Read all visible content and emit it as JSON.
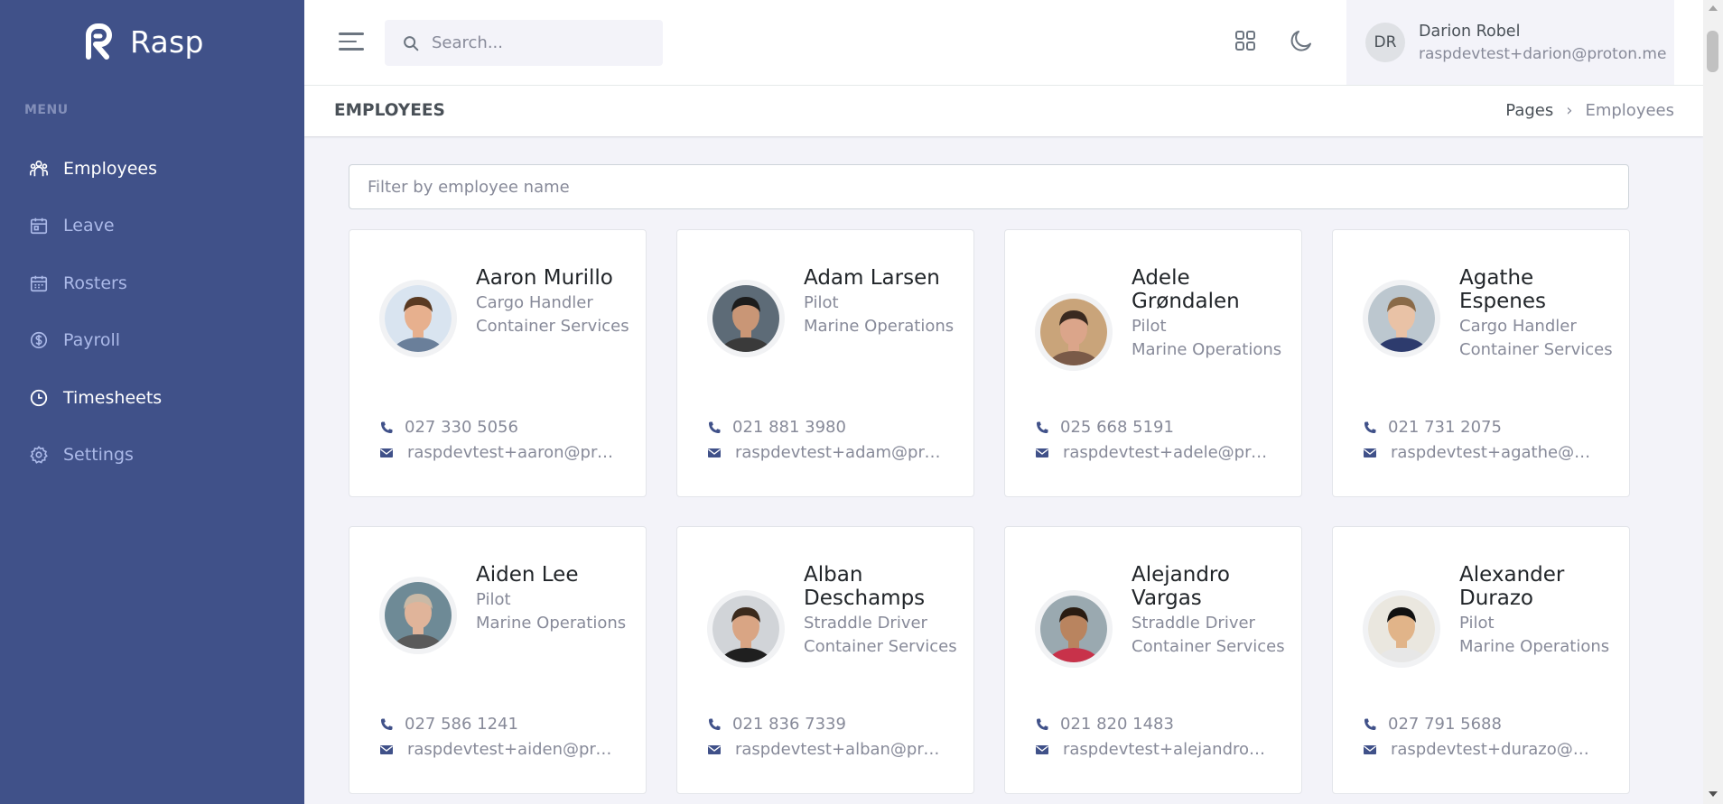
{
  "app": {
    "name": "Rasp"
  },
  "sidebar": {
    "menu_title": "MENU",
    "items": [
      {
        "label": "Employees",
        "icon": "users-icon"
      },
      {
        "label": "Leave",
        "icon": "calendar-icon"
      },
      {
        "label": "Rosters",
        "icon": "calendar-grid-icon"
      },
      {
        "label": "Payroll",
        "icon": "dollar-circle-icon"
      },
      {
        "label": "Timesheets",
        "icon": "clock-icon"
      },
      {
        "label": "Settings",
        "icon": "gear-icon"
      }
    ]
  },
  "topbar": {
    "search_placeholder": "Search...",
    "user": {
      "initials": "DR",
      "name": "Darion Robel",
      "email": "raspdevtest+darion@proton.me"
    }
  },
  "page": {
    "title": "EMPLOYEES",
    "breadcrumb": {
      "parent": "Pages",
      "separator": "›",
      "current": "Employees"
    },
    "filter_placeholder": "Filter by employee name"
  },
  "employees": [
    {
      "name": "Aaron Murillo",
      "role": "Cargo Handler",
      "dept": "Container Services",
      "phone": "027 330 5056",
      "email": "raspdevtest+aaron@pro..."
    },
    {
      "name": "Adam Larsen",
      "role": "Pilot",
      "dept": "Marine Operations",
      "phone": "021 881 3980",
      "email": "raspdevtest+adam@pro..."
    },
    {
      "name": "Adele Grøndalen",
      "role": "Pilot",
      "dept": "Marine Operations",
      "phone": "025 668 5191",
      "email": "raspdevtest+adele@pro..."
    },
    {
      "name": "Agathe Espenes",
      "role": "Cargo Handler",
      "dept": "Container Services",
      "phone": "021 731 2075",
      "email": "raspdevtest+agathe@pr..."
    },
    {
      "name": "Aiden Lee",
      "role": "Pilot",
      "dept": "Marine Operations",
      "phone": "027 586 1241",
      "email": "raspdevtest+aiden@pro..."
    },
    {
      "name": "Alban Deschamps",
      "role": "Straddle Driver",
      "dept": "Container Services",
      "phone": "021 836 7339",
      "email": "raspdevtest+alban@pro..."
    },
    {
      "name": "Alejandro Vargas",
      "role": "Straddle Driver",
      "dept": "Container Services",
      "phone": "021 820 1483",
      "email": "raspdevtest+alejandro@..."
    },
    {
      "name": "Alexander Durazo",
      "role": "Pilot",
      "dept": "Marine Operations",
      "phone": "027 791 5688",
      "email": "raspdevtest+durazo@pr..."
    }
  ],
  "colors": {
    "sidebar": "#405189",
    "accent": "#405189",
    "body": "#f3f3f9"
  }
}
